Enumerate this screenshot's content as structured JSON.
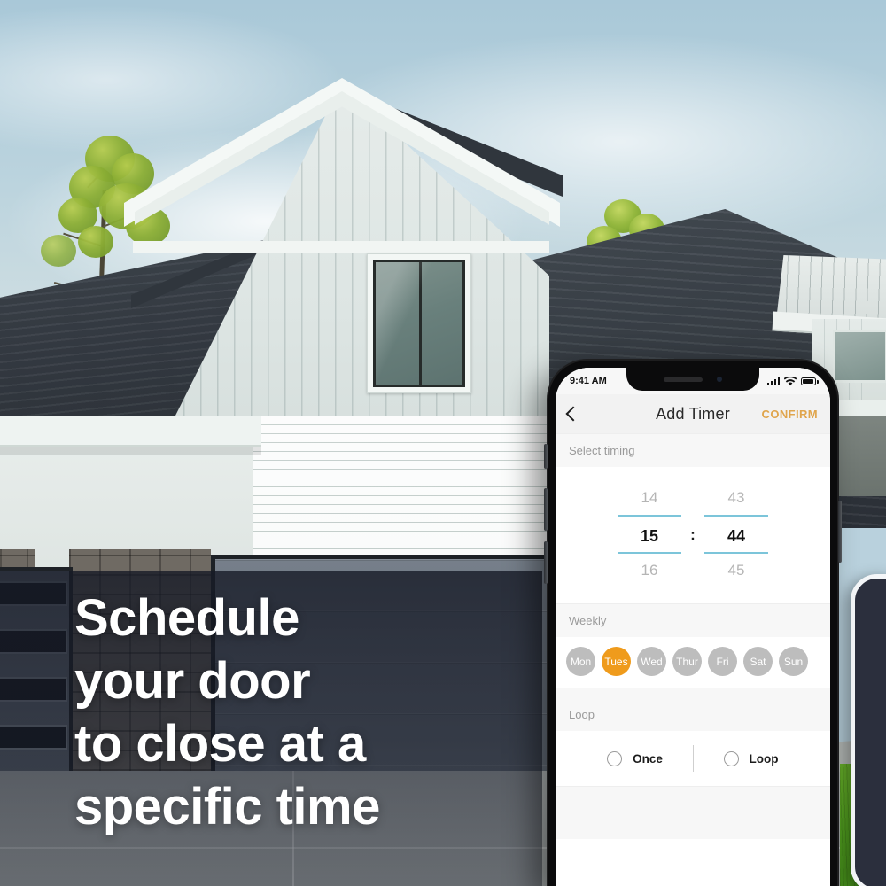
{
  "promo": {
    "headline_lines": [
      "Schedule",
      "your door",
      "to close at a",
      "specific time"
    ]
  },
  "phone": {
    "status_bar": {
      "time": "9:41 AM",
      "signal_icon": "cellular-bars-icon",
      "wifi_icon": "wifi-icon",
      "battery_icon": "battery-icon"
    },
    "navbar": {
      "back_icon": "back-chevron-icon",
      "title": "Add Timer",
      "confirm_label": "CONFIRM",
      "confirm_color": "#e0a54c"
    },
    "sections": {
      "timing": {
        "label": "Select timing",
        "picker": {
          "hour_prev": "14",
          "hour_selected": "15",
          "hour_next": "16",
          "separator": ":",
          "minute_prev": "43",
          "minute_selected": "44",
          "minute_next": "45",
          "highlight_color": "#7cc5da"
        }
      },
      "weekly": {
        "label": "Weekly",
        "days": [
          {
            "label": "Mon",
            "selected": false
          },
          {
            "label": "Tues",
            "selected": true
          },
          {
            "label": "Wed",
            "selected": false
          },
          {
            "label": "Thur",
            "selected": false
          },
          {
            "label": "Fri",
            "selected": false
          },
          {
            "label": "Sat",
            "selected": false
          },
          {
            "label": "Sun",
            "selected": false
          }
        ],
        "selected_color": "#ef9b1c",
        "unselected_color": "#bdbdbd"
      },
      "loop": {
        "label": "Loop",
        "options": [
          {
            "label": "Once",
            "selected": false
          },
          {
            "label": "Loop",
            "selected": false
          }
        ]
      }
    }
  }
}
